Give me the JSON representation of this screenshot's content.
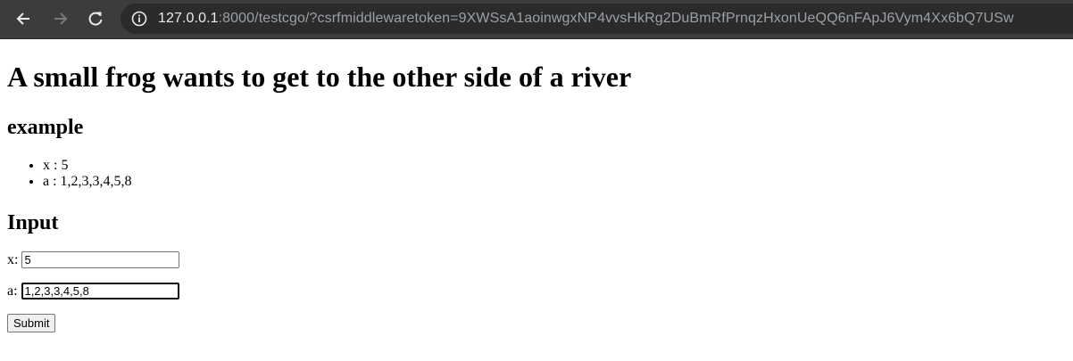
{
  "browser": {
    "url_host": "127.0.0.1",
    "url_rest": ":8000/testcgo/?csrfmiddlewaretoken=9XWSsA1aoinwgxNP4vvsHkRg2DuBmRfPrnqzHxonUeQQ6nFApJ6Vym4Xx6bQ7USw",
    "icons": [
      "back-arrow-icon",
      "forward-arrow-icon",
      "reload-icon",
      "site-info-icon"
    ]
  },
  "page": {
    "title": "A small frog wants to get to the other side of a river",
    "example_heading": "example",
    "examples": [
      {
        "text": "x : 5"
      },
      {
        "text": "a : 1,2,3,3,4,5,8"
      }
    ],
    "input_heading": "Input",
    "form": {
      "x_label": "x:",
      "x_value": "5",
      "a_label": "a:",
      "a_value": "1,2,3,3,4,5,8",
      "submit_label": "Submit"
    }
  }
}
